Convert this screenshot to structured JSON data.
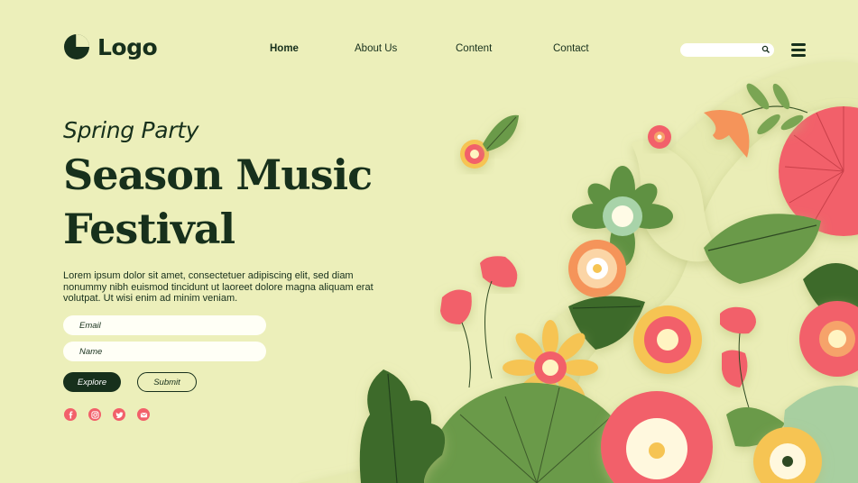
{
  "header": {
    "logo_text": "Logo",
    "nav": [
      {
        "label": "Home",
        "active": true
      },
      {
        "label": "About Us",
        "active": false
      },
      {
        "label": "Content",
        "active": false
      },
      {
        "label": "Contact",
        "active": false
      }
    ],
    "search_placeholder": "",
    "menu_icon": "hamburger-menu-icon"
  },
  "hero": {
    "subtitle": "Spring Party",
    "title_line1": "Season Music",
    "title_line2": "Festival",
    "description": "Lorem ipsum dolor sit amet, consectetuer adipiscing elit, sed diam nonummy nibh euismod tincidunt ut laoreet dolore magna aliquam erat volutpat. Ut wisi enim ad minim veniam."
  },
  "form": {
    "email_placeholder": "Email",
    "name_placeholder": "Name",
    "explore_label": "Explore",
    "submit_label": "Submit"
  },
  "social": [
    "facebook-icon",
    "instagram-icon",
    "twitter-icon",
    "email-icon"
  ],
  "colors": {
    "background": "#ecefba",
    "dark_green": "#17301c",
    "coral": "#f2606a",
    "leaf_green": "#6a9a4a",
    "yellow": "#f6c453"
  }
}
